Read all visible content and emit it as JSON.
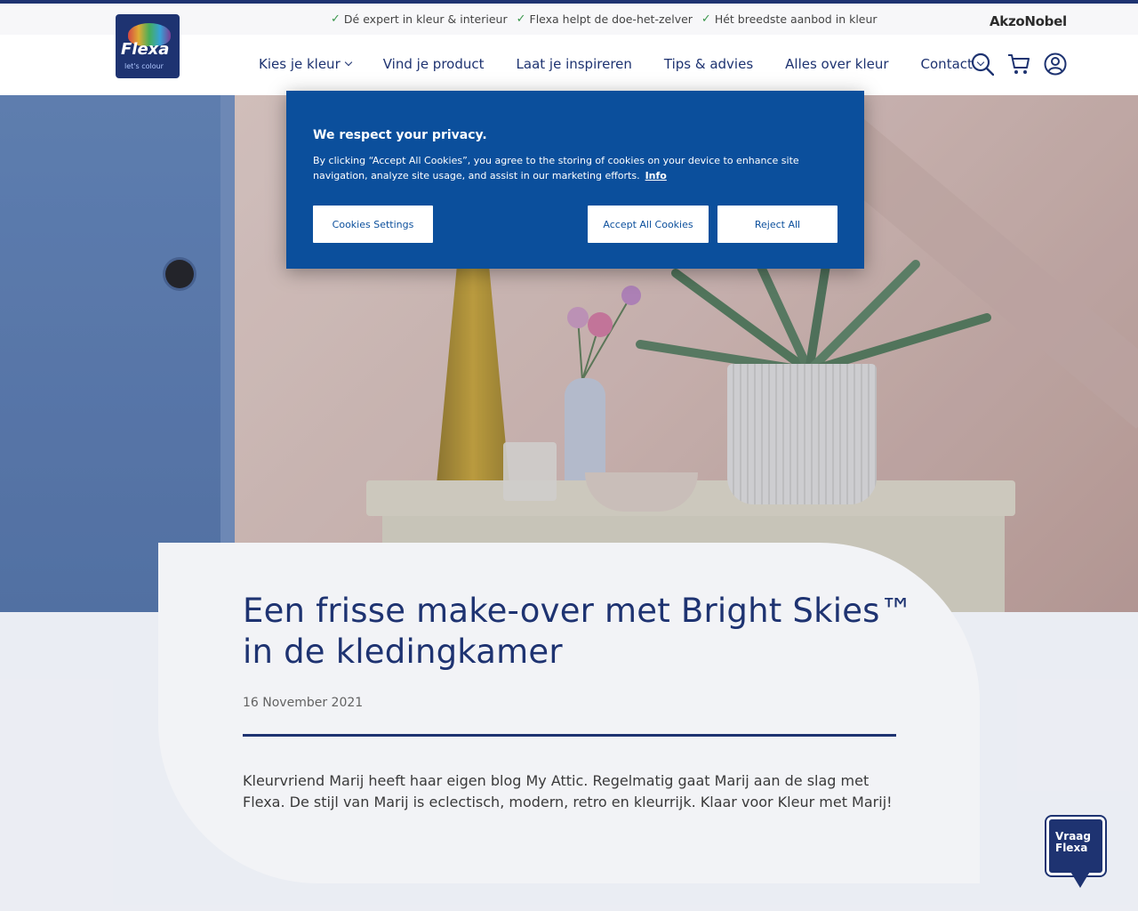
{
  "usp_bar": {
    "items": [
      "Dé expert in kleur & interieur",
      "Flexa helpt de doe-het-zelver",
      "Hét breedste aanbod in kleur"
    ],
    "corporate_brand": "AkzoNobel"
  },
  "logo": {
    "brand": "Flexa",
    "tagline": "let's colour"
  },
  "nav": {
    "items": [
      {
        "label": "Kies je kleur",
        "has_dropdown": true
      },
      {
        "label": "Vind je product",
        "has_dropdown": false
      },
      {
        "label": "Laat je inspireren",
        "has_dropdown": false
      },
      {
        "label": "Tips & advies",
        "has_dropdown": false
      },
      {
        "label": "Alles over kleur",
        "has_dropdown": false
      },
      {
        "label": "Contact",
        "has_dropdown": true
      }
    ],
    "icons": [
      "search-icon",
      "cart-icon",
      "account-icon"
    ]
  },
  "article": {
    "title": "Een frisse make-over met Bright Skies™ in de kledingkamer",
    "date": "16 November 2021",
    "intro": "Kleurvriend Marij heeft haar eigen blog My Attic. Regelmatig gaat Marij aan de slag met Flexa. De stijl van Marij is eclectisch, modern, retro en kleurrijk. Klaar voor Kleur met Marij!"
  },
  "cookie_banner": {
    "title": "We respect your privacy.",
    "text": "By clicking “Accept All Cookies”, you agree to the storing of cookies on your device to enhance site navigation, analyze site usage, and assist in our marketing efforts.",
    "info_link": "Info",
    "settings_label": "Cookies Settings",
    "accept_label": "Accept All Cookies",
    "reject_label": "Reject All"
  },
  "chat_widget": {
    "line1": "Vraag",
    "line2": "Flexa"
  },
  "colors": {
    "brand_navy": "#0b2265",
    "cookie_blue": "#0b4f9c",
    "check_green": "#2b8f3e"
  }
}
